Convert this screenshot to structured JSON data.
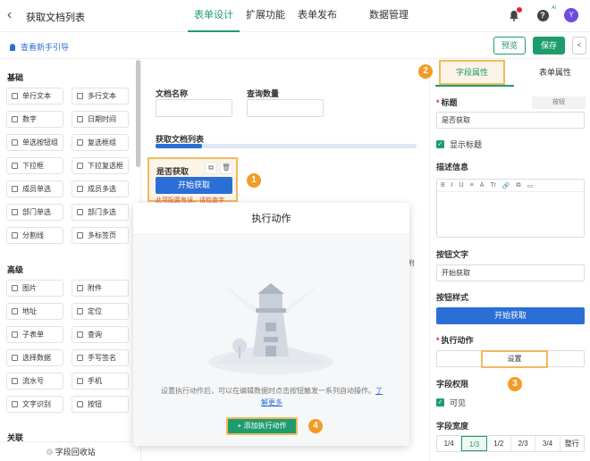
{
  "header": {
    "back_glyph": "‹",
    "title": "获取文档列表",
    "tabs": [
      "表单设计",
      "扩展功能",
      "表单发布",
      "数据管理"
    ],
    "avatar_letter": "Y",
    "help_glyph": "?",
    "help_sup": "AI"
  },
  "subbar": {
    "guide": "查看新手引导",
    "preview": "预览",
    "save": "保存",
    "share_glyph": "<"
  },
  "left": {
    "sections": [
      "基础",
      "高级",
      "关联"
    ],
    "basic": [
      "单行文本",
      "多行文本",
      "数字",
      "日期时间",
      "单选按钮组",
      "复选框组",
      "下拉框",
      "下拉复选框",
      "成员单选",
      "成员多选",
      "部门单选",
      "部门多选",
      "分割线",
      "多标签页"
    ],
    "advanced": [
      "图片",
      "附件",
      "地址",
      "定位",
      "子表单",
      "查询",
      "选择数据",
      "手写签名",
      "流水号",
      "手机",
      "文字识别",
      "按钮"
    ],
    "recycle": "字段回收站"
  },
  "canvas": {
    "field1": "文档名称",
    "field2": "查询数量",
    "table_title": "获取文档列表",
    "selected_title": "是否获取",
    "selected_button": "开始获取",
    "selected_error": "此项配置有误，请检查字",
    "copy_glyph": "⧉",
    "delete_glyph": "🗑",
    "partial_text": "附"
  },
  "modal": {
    "title": "执行动作",
    "desc": "设置执行动作后，可以在编辑数据时点击按钮触发一系列自动操作。",
    "link": "了解更多",
    "add_button": "+ 添加执行动作"
  },
  "right": {
    "tabs": [
      "字段属性",
      "表单属性"
    ],
    "title_label": "标题",
    "title_tag": "按钮",
    "title_value": "是否获取",
    "show_title": "显示标题",
    "desc_label": "描述信息",
    "editor_tools": [
      "B",
      "I",
      "U",
      "≡",
      "A",
      "Tr",
      "🔗",
      "⧉",
      "▭"
    ],
    "btn_text_label": "按钮文字",
    "btn_text_value": "开始获取",
    "btn_style_label": "按钮样式",
    "btn_style_value": "开始获取",
    "action_label": "执行动作",
    "action_button": "设置",
    "perm_label": "字段权限",
    "visible": "可见",
    "width_label": "字段宽度",
    "widths": [
      "1/4",
      "1/3",
      "1/2",
      "2/3",
      "3/4",
      "整行"
    ],
    "width_selected": "1/3"
  },
  "markers": [
    "1",
    "2",
    "3",
    "4"
  ],
  "colors": {
    "primary": "#1f9c6b",
    "blue": "#2b6fd6",
    "highlight": "#f3b860",
    "marker": "#f29b26"
  }
}
